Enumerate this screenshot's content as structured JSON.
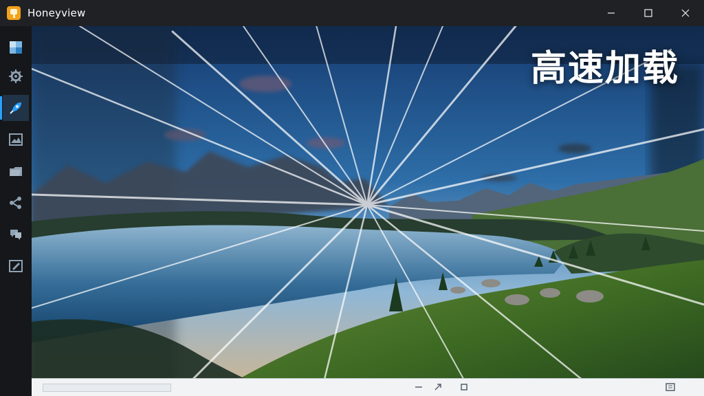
{
  "window": {
    "title": "Honeyview",
    "buttons": [
      "minimize",
      "maximize",
      "close"
    ]
  },
  "sidebar": {
    "items": [
      {
        "name": "thumbnail",
        "icon": "photo-grid-icon",
        "active": false
      },
      {
        "name": "settings",
        "icon": "gear-icon",
        "active": false
      },
      {
        "name": "speed",
        "icon": "rocket-icon",
        "active": true
      },
      {
        "name": "image",
        "icon": "landscape-icon",
        "active": false
      },
      {
        "name": "folder",
        "icon": "folder-icon",
        "active": false
      },
      {
        "name": "share",
        "icon": "share-icon",
        "active": false
      },
      {
        "name": "chat",
        "icon": "chat-icon",
        "active": false
      },
      {
        "name": "edit",
        "icon": "edit-icon",
        "active": false
      }
    ]
  },
  "overlay": {
    "headline": "高速加载"
  },
  "statusbar": {
    "icons": [
      "minus-icon",
      "arrow-icon",
      "square-icon",
      "fit-window-icon"
    ]
  },
  "colors": {
    "accent": "#2aa0ff",
    "titlebar": "#202124",
    "sidebar": "#15171a",
    "sky_top": "#2d6ba6",
    "water": "#2b5f8d",
    "grass": "#4e7930"
  }
}
